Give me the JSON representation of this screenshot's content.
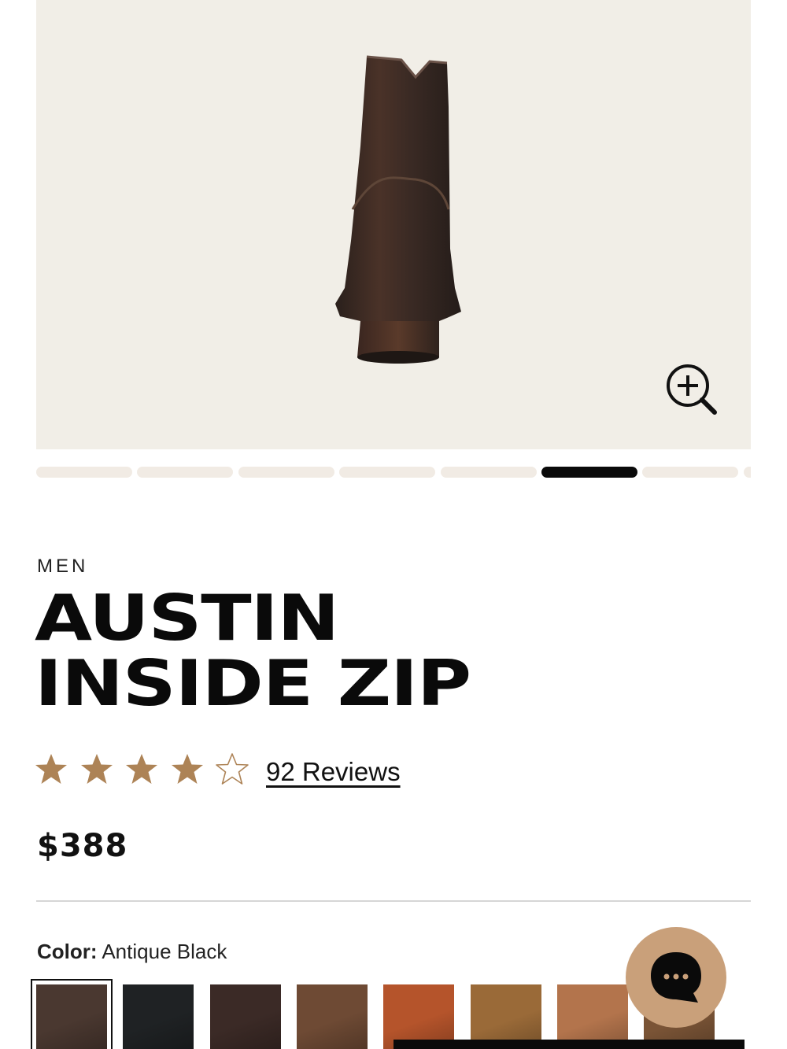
{
  "product": {
    "category": "MEN",
    "title_lines": [
      "AUSTIN",
      "INSIDE ZIP"
    ],
    "rating": 4,
    "rating_max": 5,
    "reviews_label": "92 Reviews",
    "price": "$388"
  },
  "gallery": {
    "total_images": 7,
    "active_index": 5,
    "background": "#f1eee7"
  },
  "color_selector": {
    "label": "Color:",
    "selected_value": "Antique Black",
    "swatches": [
      {
        "color": "#4a3830",
        "selected": true
      },
      {
        "color": "#1f2224",
        "selected": false
      },
      {
        "color": "#3b2a26",
        "selected": false
      },
      {
        "color": "#6e4a34",
        "selected": false
      },
      {
        "color": "#b5542b",
        "selected": false
      },
      {
        "color": "#9a6a38",
        "selected": false
      },
      {
        "color": "#b3744c",
        "selected": false
      },
      {
        "color": "#7a5436",
        "selected": false
      }
    ]
  },
  "colors": {
    "star": "#ad8356",
    "chat_button": "#c9a07a",
    "active_indicator": "#0a0a0a",
    "inactive_indicator": "#f1ebe4"
  },
  "icons": {
    "zoom": "zoom-in-icon",
    "chat": "chat-bubble-icon",
    "star_filled": "star-filled-icon",
    "star_empty": "star-outline-icon"
  }
}
